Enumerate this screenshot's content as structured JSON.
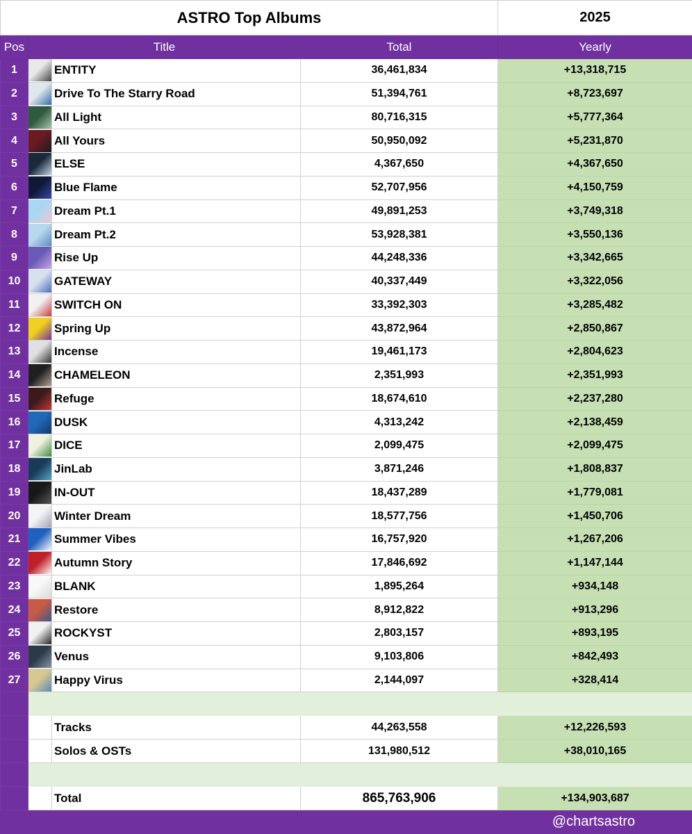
{
  "header": {
    "title": "ASTRO Top Albums",
    "year": "2025",
    "columns": {
      "pos": "Pos",
      "title": "Title",
      "total": "Total",
      "yearly": "Yearly"
    }
  },
  "albums": [
    {
      "pos": "1",
      "title": "ENTITY",
      "total": "36,461,834",
      "yearly": "+13,318,715",
      "art": [
        "#e8e8e8",
        "#404040"
      ]
    },
    {
      "pos": "2",
      "title": "Drive To The Starry Road",
      "total": "51,394,761",
      "yearly": "+8,723,697",
      "art": [
        "#dfe6ee",
        "#2c6aa0"
      ]
    },
    {
      "pos": "3",
      "title": "All Light",
      "total": "80,716,315",
      "yearly": "+5,777,364",
      "art": [
        "#2f5a3e",
        "#a8c8b0"
      ]
    },
    {
      "pos": "4",
      "title": "All Yours",
      "total": "50,950,092",
      "yearly": "+5,231,870",
      "art": [
        "#6a1a22",
        "#1a1a22"
      ]
    },
    {
      "pos": "5",
      "title": "ELSE",
      "total": "4,367,650",
      "yearly": "+4,367,650",
      "art": [
        "#1a2a3a",
        "#c8d8e8"
      ]
    },
    {
      "pos": "6",
      "title": "Blue Flame",
      "total": "52,707,956",
      "yearly": "+4,150,759",
      "art": [
        "#101838",
        "#3a4aa8"
      ]
    },
    {
      "pos": "7",
      "title": "Dream Pt.1",
      "total": "49,891,253",
      "yearly": "+3,749,318",
      "art": [
        "#a8d8f0",
        "#f0c8d8"
      ]
    },
    {
      "pos": "8",
      "title": "Dream Pt.2",
      "total": "53,928,381",
      "yearly": "+3,550,136",
      "art": [
        "#b8d8f0",
        "#5a8ab8"
      ]
    },
    {
      "pos": "9",
      "title": "Rise Up",
      "total": "44,248,336",
      "yearly": "+3,342,665",
      "art": [
        "#6a5ab8",
        "#c8a8e8"
      ]
    },
    {
      "pos": "10",
      "title": "GATEWAY",
      "total": "40,337,449",
      "yearly": "+3,322,056",
      "art": [
        "#d8e0f0",
        "#4a6ab8"
      ]
    },
    {
      "pos": "11",
      "title": "SWITCH ON",
      "total": "33,392,303",
      "yearly": "+3,285,482",
      "art": [
        "#f0f0f0",
        "#c83838"
      ]
    },
    {
      "pos": "12",
      "title": "Spring Up",
      "total": "43,872,964",
      "yearly": "+2,850,867",
      "art": [
        "#f0d020",
        "#7030a0"
      ]
    },
    {
      "pos": "13",
      "title": "Incense",
      "total": "19,461,173",
      "yearly": "+2,804,623",
      "art": [
        "#e0e0e0",
        "#303030"
      ]
    },
    {
      "pos": "14",
      "title": "CHAMELEON",
      "total": "2,351,993",
      "yearly": "+2,351,993",
      "art": [
        "#202020",
        "#b8a8a0"
      ]
    },
    {
      "pos": "15",
      "title": "Refuge",
      "total": "18,674,610",
      "yearly": "+2,237,280",
      "art": [
        "#3a1a1a",
        "#c83838"
      ]
    },
    {
      "pos": "16",
      "title": "DUSK",
      "total": "4,313,242",
      "yearly": "+2,138,459",
      "art": [
        "#2068b8",
        "#103868"
      ]
    },
    {
      "pos": "17",
      "title": "DICE",
      "total": "2,099,475",
      "yearly": "+2,099,475",
      "art": [
        "#f0f0e0",
        "#3a8a3a"
      ]
    },
    {
      "pos": "18",
      "title": "JinLab",
      "total": "3,871,246",
      "yearly": "+1,808,837",
      "art": [
        "#1a3a5a",
        "#58a8c8"
      ]
    },
    {
      "pos": "19",
      "title": "IN-OUT",
      "total": "18,437,289",
      "yearly": "+1,779,081",
      "art": [
        "#181818",
        "#585858"
      ]
    },
    {
      "pos": "20",
      "title": "Winter Dream",
      "total": "18,577,756",
      "yearly": "+1,450,706",
      "art": [
        "#f4f4f8",
        "#a0a0b0"
      ]
    },
    {
      "pos": "21",
      "title": "Summer Vibes",
      "total": "16,757,920",
      "yearly": "+1,267,206",
      "art": [
        "#2060c0",
        "#ffffff"
      ]
    },
    {
      "pos": "22",
      "title": "Autumn Story",
      "total": "17,846,692",
      "yearly": "+1,147,144",
      "art": [
        "#c02028",
        "#ffffff"
      ]
    },
    {
      "pos": "23",
      "title": "BLANK",
      "total": "1,895,264",
      "yearly": "+934,148",
      "art": [
        "#f8f8f8",
        "#d8d8d8"
      ]
    },
    {
      "pos": "24",
      "title": "Restore",
      "total": "8,912,822",
      "yearly": "+913,296",
      "art": [
        "#c85a48",
        "#3a5a8a"
      ]
    },
    {
      "pos": "25",
      "title": "ROCKYST",
      "total": "2,803,157",
      "yearly": "+893,195",
      "art": [
        "#f0f0f0",
        "#202020"
      ]
    },
    {
      "pos": "26",
      "title": "Venus",
      "total": "9,103,806",
      "yearly": "+842,493",
      "art": [
        "#2a3a48",
        "#8898a8"
      ]
    },
    {
      "pos": "27",
      "title": "Happy Virus",
      "total": "2,144,097",
      "yearly": "+328,414",
      "art": [
        "#d8c890",
        "#5888b8"
      ]
    }
  ],
  "summary": {
    "tracks": {
      "title": "Tracks",
      "total": "44,263,558",
      "yearly": "+12,226,593"
    },
    "solos": {
      "title": "Solos & OSTs",
      "total": "131,980,512",
      "yearly": "+38,010,165"
    },
    "total": {
      "title": "Total",
      "total": "865,763,906",
      "yearly": "+134,903,687"
    }
  },
  "footer": {
    "handle": "@chartsastro"
  },
  "colors": {
    "purple": "#7030a0",
    "green": "#c6e0b4",
    "light_green": "#e2efda"
  }
}
